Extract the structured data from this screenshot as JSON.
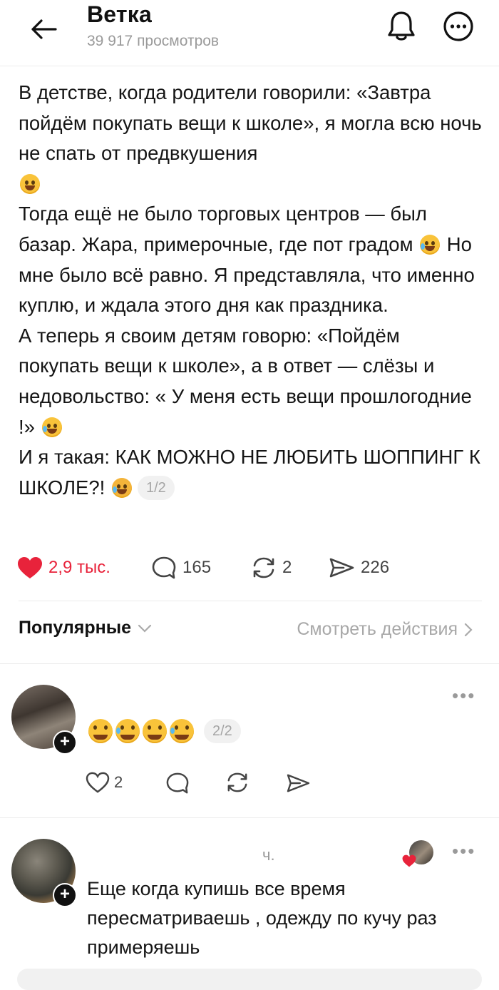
{
  "header": {
    "title": "Ветка",
    "views": "39 917 просмотров"
  },
  "post": {
    "paragraphs": [
      "В детстве, когда родители говорили: «Завтра пойдём покупать вещи к школе», я могла всю ночь не спать от предвкушения",
      "Тогда ещё не было торговых центров — был базар. Жара, примерочные, где пот градом",
      "Но мне было всё равно. Я представляла, что именно куплю, и ждала этого дня как праздника.",
      "А теперь я своим детям говорю: «Пойдём покупать вещи к школе», а в ответ — слёзы и недовольство: « У меня есть вещи прошлогодние !»",
      "И я такая: КАК МОЖНО НЕ ЛЮБИТЬ ШОППИНГ К ШКОЛЕ?!"
    ],
    "page_indicator": "1/2",
    "likes": "2,9 тыс.",
    "comments": "165",
    "reposts": "2",
    "shares": "226"
  },
  "comments_section": {
    "sort_label": "Популярные",
    "see_actions": "Смотреть действия"
  },
  "comment1": {
    "page_indicator": "2/2",
    "likes": "2"
  },
  "comment2": {
    "time": "ч.",
    "text": "Еще когда купишь все время пересматриваешь , одежду по кучу раз примеряешь"
  },
  "colors": {
    "like_red": "#e8233b",
    "muted": "#9a9a9a",
    "emoji_yellow": "#f9c33a"
  }
}
